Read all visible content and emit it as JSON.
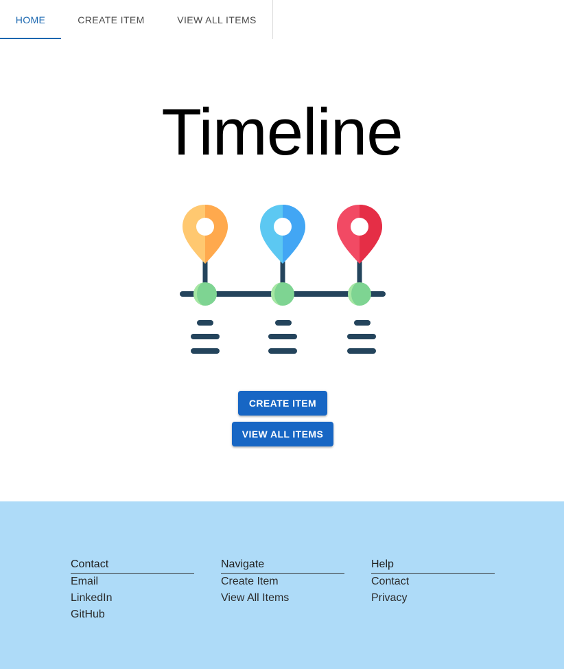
{
  "nav": {
    "tabs": [
      {
        "label": "HOME",
        "active": true
      },
      {
        "label": "CREATE ITEM",
        "active": false
      },
      {
        "label": "VIEW ALL ITEMS",
        "active": false
      }
    ]
  },
  "hero": {
    "title": "Timeline",
    "illustration": "timeline-pins-icon",
    "pin_colors": [
      "#FFB74D",
      "#4FB3F6",
      "#EC3950"
    ]
  },
  "actions": {
    "create_label": "CREATE ITEM",
    "view_label": "VIEW ALL ITEMS"
  },
  "footer": {
    "columns": [
      {
        "heading": "Contact",
        "links": [
          "Email",
          "LinkedIn",
          "GitHub"
        ]
      },
      {
        "heading": "Navigate",
        "links": [
          "Create Item",
          "View All Items"
        ]
      },
      {
        "heading": "Help",
        "links": [
          "Contact",
          "Privacy"
        ]
      }
    ]
  },
  "colors": {
    "accent": "#1766c4",
    "tab_active": "#1a67b0",
    "footer_bg": "#aedbf8"
  }
}
